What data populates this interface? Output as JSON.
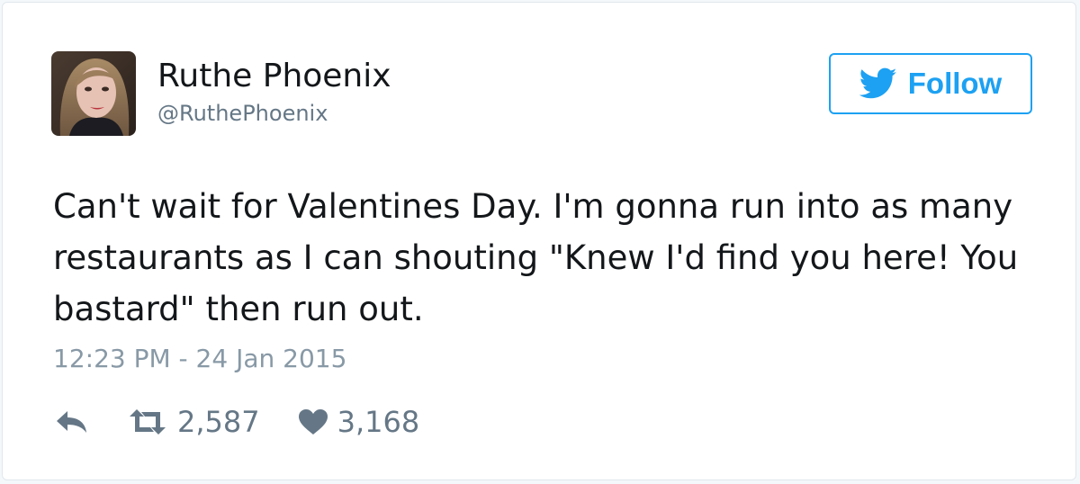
{
  "user": {
    "display_name": "Ruthe Phoenix",
    "handle": "@RuthePhoenix",
    "avatar_icon": "profile-photo"
  },
  "follow_button": {
    "label": "Follow",
    "icon": "twitter-bird-icon",
    "color": "#1da1f2"
  },
  "tweet": {
    "text": "Can't wait for Valentines Day. I'm gonna run into as many restaurants as I can shouting \"Knew I'd find you here! You bastard\" then run out.",
    "timestamp": "12:23 PM - 24 Jan 2015"
  },
  "actions": {
    "reply_icon": "reply-icon",
    "retweet_icon": "retweet-icon",
    "retweet_count": "2,587",
    "like_icon": "heart-icon",
    "like_count": "3,168"
  },
  "colors": {
    "text_primary": "#14171a",
    "text_secondary": "#657786",
    "text_muted": "#8899a6",
    "accent": "#1da1f2",
    "border": "#e1e8ed"
  }
}
